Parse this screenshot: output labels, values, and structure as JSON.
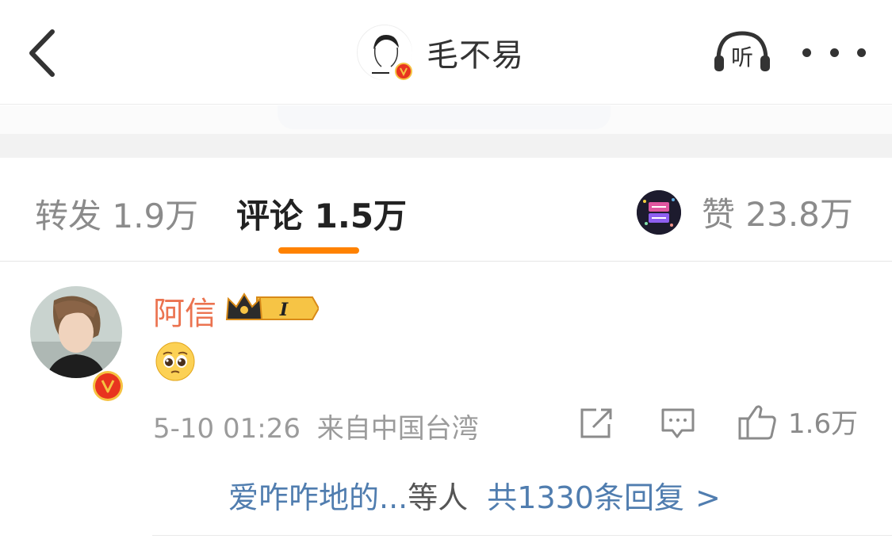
{
  "header": {
    "title": "毛不易",
    "listen_label": "听"
  },
  "tabs": {
    "repost_label": "转发",
    "repost_count": "1.9万",
    "comment_label": "评论",
    "comment_count": "1.5万",
    "like_label": "赞",
    "like_count": "23.8万"
  },
  "comment": {
    "username": "阿信",
    "level_badge": "I",
    "content_emoji": "pleading-face",
    "date": "5-10 01:26",
    "source": "来自中国台湾",
    "like_count": "1.6万",
    "replies": {
      "users": "爱咋咋地的...",
      "etc": "等人",
      "total": "共1330条回复",
      "arrow": ">"
    }
  },
  "colors": {
    "accent_orange": "#ff8200",
    "username_orange": "#eb7350",
    "link_blue": "#507daf",
    "verified_red": "#e8341f",
    "verified_yellow": "#f5c242"
  }
}
